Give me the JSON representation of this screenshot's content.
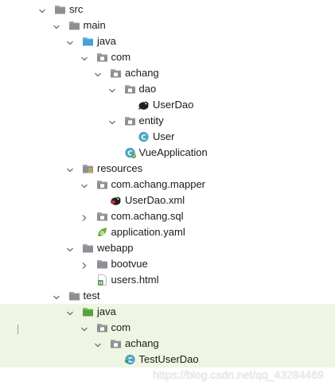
{
  "project_tree": {
    "rows": [
      {
        "label": "src",
        "icon": "folder-plain-icon",
        "arrow": "expanded",
        "level": 0,
        "highlight": false
      },
      {
        "label": "main",
        "icon": "folder-plain-icon",
        "arrow": "expanded",
        "level": 1,
        "highlight": false
      },
      {
        "label": "java",
        "icon": "folder-source-icon",
        "arrow": "expanded",
        "level": 2,
        "highlight": false
      },
      {
        "label": "com",
        "icon": "package-icon",
        "arrow": "expanded",
        "level": 3,
        "highlight": false
      },
      {
        "label": "achang",
        "icon": "package-icon",
        "arrow": "expanded",
        "level": 4,
        "highlight": false
      },
      {
        "label": "dao",
        "icon": "package-icon",
        "arrow": "expanded",
        "level": 5,
        "highlight": false
      },
      {
        "label": "UserDao",
        "icon": "mybatis-bird-icon",
        "arrow": "none",
        "level": 6,
        "highlight": false
      },
      {
        "label": "entity",
        "icon": "package-icon",
        "arrow": "expanded",
        "level": 5,
        "highlight": false
      },
      {
        "label": "User",
        "icon": "java-class-icon",
        "arrow": "none",
        "level": 6,
        "highlight": false
      },
      {
        "label": "VueApplication",
        "icon": "spring-boot-class-icon",
        "arrow": "none",
        "level": 5,
        "highlight": false
      },
      {
        "label": "resources",
        "icon": "folder-resources-icon",
        "arrow": "expanded",
        "level": 2,
        "highlight": false
      },
      {
        "label": "com.achang.mapper",
        "icon": "package-icon",
        "arrow": "expanded",
        "level": 3,
        "highlight": false
      },
      {
        "label": "UserDao.xml",
        "icon": "mybatis-xml-icon",
        "arrow": "none",
        "level": 4,
        "highlight": false
      },
      {
        "label": "com.achang.sql",
        "icon": "package-icon",
        "arrow": "collapsed",
        "level": 3,
        "highlight": false
      },
      {
        "label": "application.yaml",
        "icon": "spring-yaml-icon",
        "arrow": "none",
        "level": 3,
        "highlight": false
      },
      {
        "label": "webapp",
        "icon": "folder-plain-icon",
        "arrow": "expanded",
        "level": 2,
        "highlight": false
      },
      {
        "label": "bootvue",
        "icon": "folder-plain-icon",
        "arrow": "collapsed",
        "level": 3,
        "highlight": false
      },
      {
        "label": "users.html",
        "icon": "html-file-icon",
        "arrow": "none",
        "level": 3,
        "highlight": false
      },
      {
        "label": "test",
        "icon": "folder-plain-icon",
        "arrow": "expanded",
        "level": 1,
        "highlight": false
      },
      {
        "label": "java",
        "icon": "folder-test-icon",
        "arrow": "expanded",
        "level": 2,
        "highlight": true
      },
      {
        "label": "com",
        "icon": "package-icon",
        "arrow": "expanded",
        "level": 3,
        "highlight": true
      },
      {
        "label": "achang",
        "icon": "package-icon",
        "arrow": "expanded",
        "level": 4,
        "highlight": true
      },
      {
        "label": "TestUserDao",
        "icon": "java-test-class-icon",
        "arrow": "none",
        "level": 5,
        "highlight": true
      }
    ]
  },
  "watermark": {
    "text": "https://blog.csdn.net/qq_43284469"
  },
  "colors": {
    "test_highlight": "#eef6e3",
    "folder_gray": "#8c8f94",
    "source_folder_blue": "#4a9fd8",
    "test_folder_green": "#5aa03c",
    "class_badge": "#4ea3c9"
  }
}
